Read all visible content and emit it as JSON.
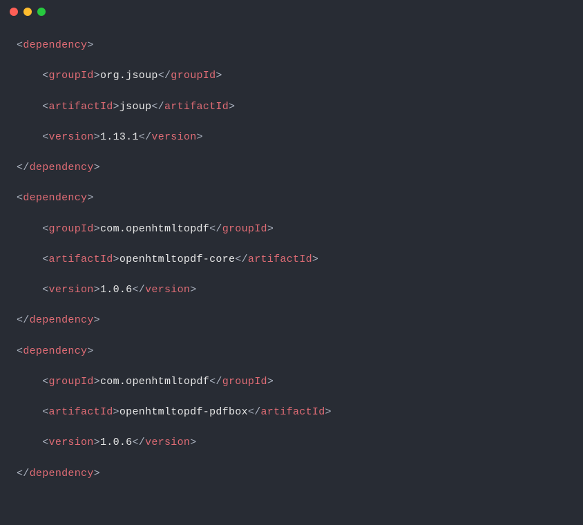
{
  "colors": {
    "bg": "#282c34",
    "angle": "#abb2bf",
    "tag": "#e06c75",
    "text": "#e6e6e6",
    "red": "#ff5f56",
    "yellow": "#ffbd2e",
    "green": "#27c93f"
  },
  "tags": {
    "dependency": "dependency",
    "groupId": "groupId",
    "artifactId": "artifactId",
    "version": "version"
  },
  "deps": [
    {
      "groupId": "org.jsoup",
      "artifactId": "jsoup",
      "version": "1.13.1"
    },
    {
      "groupId": "com.openhtmltopdf",
      "artifactId": "openhtmltopdf-core",
      "version": "1.0.6"
    },
    {
      "groupId": "com.openhtmltopdf",
      "artifactId": "openhtmltopdf-pdfbox",
      "version": "1.0.6"
    }
  ]
}
